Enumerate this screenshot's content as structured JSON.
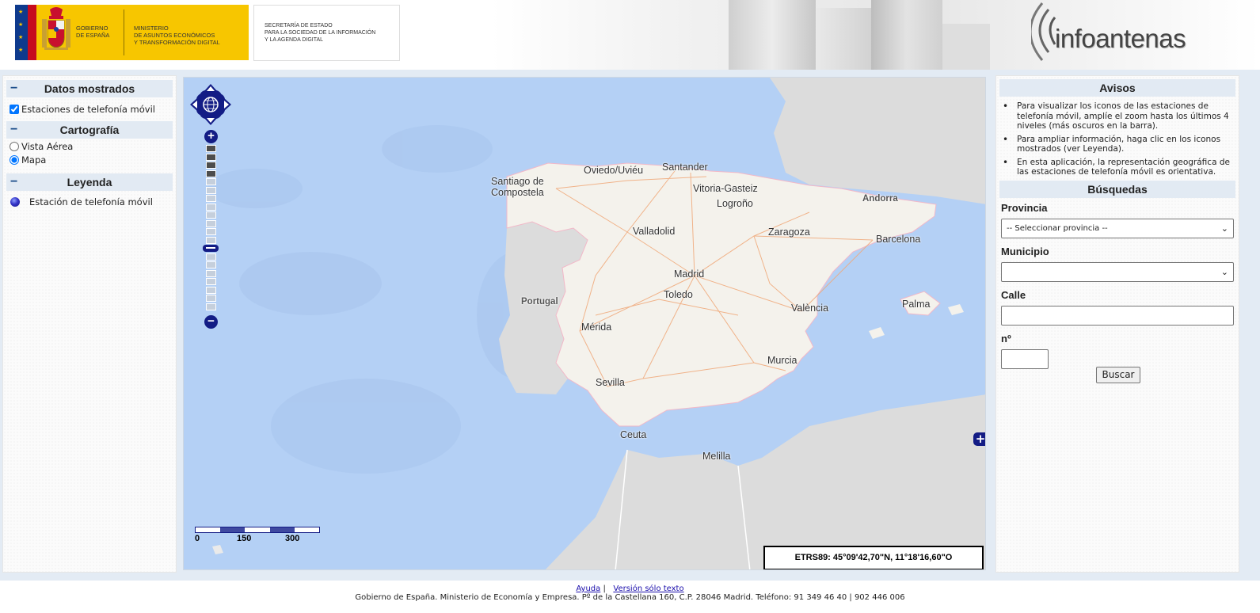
{
  "header": {
    "gov_line1": "GOBIERNO",
    "gov_line2": "DE ESPAÑA",
    "ministry_line1": "MINISTERIO",
    "ministry_line2": "DE ASUNTOS ECONÓMICOS",
    "ministry_line3": "Y TRANSFORMACIÓN DIGITAL",
    "secretariat_line1": "SECRETARÍA DE ESTADO",
    "secretariat_line2": "PARA LA SOCIEDAD DE LA INFORMACIÓN",
    "secretariat_line3": "Y LA AGENDA DIGITAL",
    "logo_text": "infoantenas"
  },
  "left_panel": {
    "datos_header": "Datos mostrados",
    "stations_label": "Estaciones de telefonía móvil",
    "stations_checked": true,
    "carto_header": "Cartografía",
    "aerial_label": "Vista Aérea",
    "map_label": "Mapa",
    "selected_layer": "Mapa",
    "legend_header": "Leyenda",
    "legend_item": "Estación de telefonía móvil",
    "collapse_symbol": "−"
  },
  "map": {
    "cities": {
      "santiago_1": "Santiago de",
      "santiago_2": "Compostela",
      "oviedo": "Oviedo/Uviéu",
      "santander": "Santander",
      "vitoria": "Vitoria-Gasteiz",
      "logrono": "Logroño",
      "andorra": "Andorra",
      "valladolid": "Valladolid",
      "zaragoza": "Zaragoza",
      "barcelona": "Barcelona",
      "madrid": "Madrid",
      "portugal": "Portugal",
      "toledo": "Toledo",
      "valencia": "València",
      "palma": "Palma",
      "merida": "Mérida",
      "murcia": "Murcia",
      "sevilla": "Sevilla",
      "ceuta": "Ceuta",
      "melilla": "Melilla"
    },
    "scale_labels": [
      "0",
      "150",
      "300"
    ],
    "coordinates": "ETRS89: 45°09'42,70\"N, 11°18'16,60\"O",
    "zoom_levels_total": 20,
    "zoom_current_level": 11,
    "dark_zoom_levels": 4
  },
  "right_panel": {
    "avisos_header": "Avisos",
    "notices": [
      "Para visualizar los iconos de las estaciones de telefonía móvil, amplíe el zoom hasta los últimos 4 niveles (más oscuros en la barra).",
      "Para ampliar información, haga clic en los iconos mostrados (ver Leyenda).",
      "En esta aplicación, la representación geográfica de las estaciones de telefonía móvil es orientativa."
    ],
    "busquedas_header": "Búsquedas",
    "provincia_label": "Provincia",
    "provincia_value": "-- Seleccionar provincia --",
    "municipio_label": "Municipio",
    "municipio_value": "",
    "calle_label": "Calle",
    "calle_value": "",
    "numero_label": "nº",
    "numero_value": "",
    "search_button": "Buscar"
  },
  "footer": {
    "help_link": "Ayuda",
    "separator": "|",
    "text_version_link": "Versión sólo texto",
    "address": "Gobierno de España. Ministerio de Economía y Empresa. Pº de la Castellana 160, C.P. 28046 Madrid. Teléfono: 91 349 46 40 | 902 446 006"
  },
  "colors": {
    "sea": "#b4d0f5",
    "land": "#f4f2ec",
    "foreign_land": "#dcdcdc",
    "roads": "#f0a878",
    "control_blue": "#131c85",
    "panel_header": "#e2eaf3",
    "gov_yellow": "#f7c600"
  }
}
